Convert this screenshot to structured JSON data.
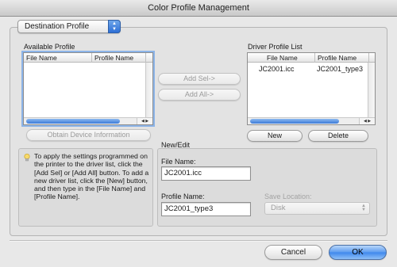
{
  "window": {
    "title": "Color Profile Management"
  },
  "mode_popup": {
    "value": "Destination Profile"
  },
  "available_profile": {
    "label": "Available Profile",
    "columns": [
      "File Name",
      "Profile Name"
    ],
    "rows": []
  },
  "driver_profile_list": {
    "label": "Driver Profile List",
    "columns": [
      "File Name",
      "Profile Name"
    ],
    "rows": [
      {
        "file": "JC2001.icc",
        "profile": "JC2001_type3"
      }
    ]
  },
  "buttons": {
    "add_sel": "Add Sel->",
    "add_all": "Add All->",
    "obtain": "Obtain Device Information",
    "new": "New",
    "delete": "Delete",
    "cancel": "Cancel",
    "ok": "OK"
  },
  "help": {
    "text": "To apply the settings programmed on the printer to the driver list, click the [Add Sel] or [Add All] button. To add a new driver list, click the [New] button, and then type in the [File Name] and [Profile Name]."
  },
  "new_edit": {
    "title": "New/Edit",
    "file_name_label": "File Name:",
    "file_name_value": "JC2001.icc",
    "profile_name_label": "Profile Name:",
    "profile_name_value": "JC2001_type3",
    "save_location_label": "Save Location:",
    "save_location_value": "Disk"
  },
  "scroll_arrows": "◀ ▶",
  "icons": {
    "popup_arrows": "updown-arrows-icon",
    "help": "lightbulb-icon"
  },
  "colors": {
    "accent": "#3d86ec",
    "focus_ring": "#8cb4e8"
  }
}
